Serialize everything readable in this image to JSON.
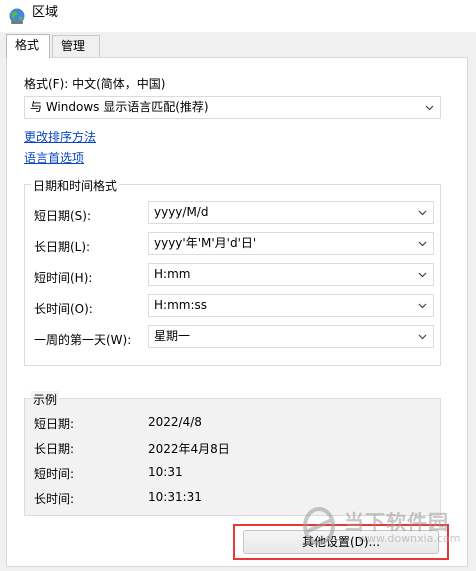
{
  "window": {
    "title": "区域",
    "title_icon": "globe-icon"
  },
  "tabs": [
    {
      "label": "格式",
      "active": true
    },
    {
      "label": "管理",
      "active": false
    }
  ],
  "format": {
    "label": "格式(F): 中文(简体，中国)",
    "dropdown_value": "与 Windows 显示语言匹配(推荐)"
  },
  "links": {
    "change_sort": "更改排序方法",
    "language_prefs": "语言首选项"
  },
  "datetime_group": {
    "title": "日期和时间格式",
    "rows": [
      {
        "label": "短日期(S):",
        "value": "yyyy/M/d"
      },
      {
        "label": "长日期(L):",
        "value": "yyyy'年'M'月'd'日'"
      },
      {
        "label": "短时间(H):",
        "value": "H:mm"
      },
      {
        "label": "长时间(O):",
        "value": "H:mm:ss"
      },
      {
        "label": "一周的第一天(W):",
        "value": "星期一"
      }
    ]
  },
  "sample_group": {
    "title": "示例",
    "rows": [
      {
        "label": "短日期:",
        "value": "2022/4/8"
      },
      {
        "label": "长日期:",
        "value": "2022年4月8日"
      },
      {
        "label": "短时间:",
        "value": "10:31"
      },
      {
        "label": "长时间:",
        "value": "10:31:31"
      }
    ]
  },
  "other_settings_button": "其他设置(D)...",
  "watermark": {
    "text": "当下软件园",
    "url": "www.downxia.com"
  },
  "colors": {
    "link": "#0a47c2",
    "highlight": "#e53935"
  }
}
